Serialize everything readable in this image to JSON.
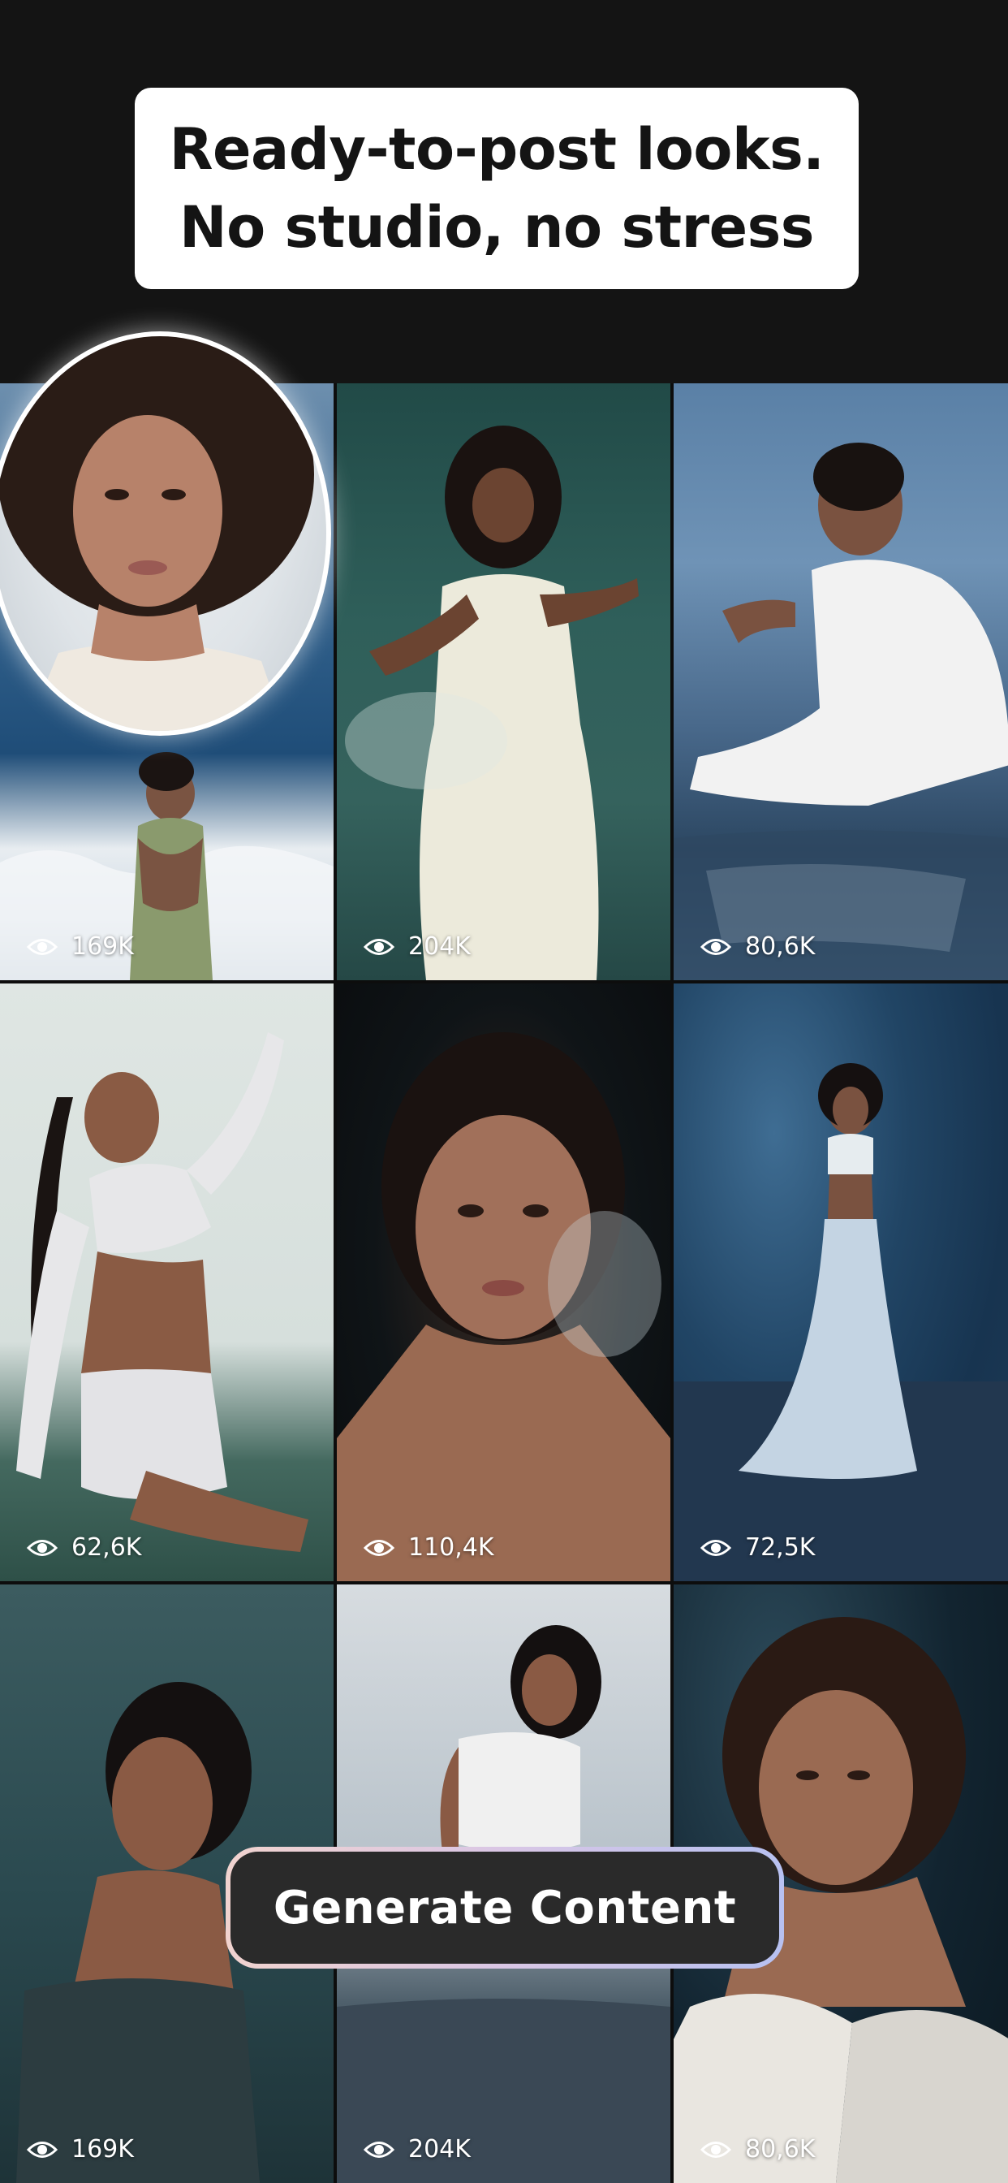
{
  "headline": {
    "line1": "Ready-to-post looks.",
    "line2": "No studio, no stress"
  },
  "grid": {
    "tiles": [
      {
        "views": "169K"
      },
      {
        "views": "204K"
      },
      {
        "views": "80,6K"
      },
      {
        "views": "62,6K"
      },
      {
        "views": "110,4K"
      },
      {
        "views": "72,5K"
      },
      {
        "views": "169K"
      },
      {
        "views": "204K"
      },
      {
        "views": "80,6K"
      }
    ]
  },
  "cta": {
    "label": "Generate Content"
  },
  "icons": {
    "views": "eye-icon"
  },
  "colors": {
    "background": "#141414",
    "headline_card": "#ffffff",
    "cta_fill": "#2a2a2a",
    "cta_border_gradient": [
      "#f1d3cf",
      "#d9c6e5",
      "#b7c1f1"
    ]
  }
}
